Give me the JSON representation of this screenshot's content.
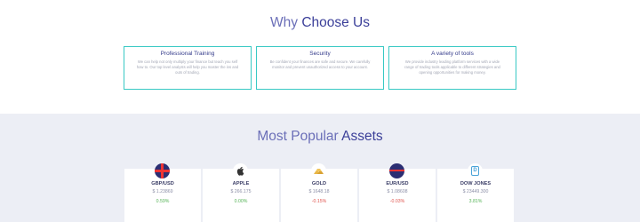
{
  "why": {
    "title_plain": "Why",
    "title_accent": "Choose Us",
    "features": [
      {
        "title": "Professional Training",
        "desc": "We can help not only multiply your finance but teach you self how to. Our top level analysts will help you master the ins and outs of trading."
      },
      {
        "title": "Security",
        "desc": "Be confident your finances are safe and secure. We carefully monitor and prevent unauthorized access to your account."
      },
      {
        "title": "A variety of tools",
        "desc": "We provide industry leading platform services with a wide range of trading tools applicable to different strategies and opening opportunities for making money."
      }
    ]
  },
  "assets": {
    "title_plain": "Most Popular",
    "title_accent": "Assets",
    "items": [
      {
        "name": "GBP/USD",
        "price": "$ 1.23869",
        "change": "0.59%",
        "trend": "pos",
        "icon": "uk-flag-icon"
      },
      {
        "name": "APPLE",
        "price": "$ 266.175",
        "change": "0.00%",
        "trend": "zero",
        "icon": "apple-icon"
      },
      {
        "name": "GOLD",
        "price": "$ 1648.18",
        "change": "-0.15%",
        "trend": "neg",
        "icon": "gold-bars-icon"
      },
      {
        "name": "EUR/USD",
        "price": "$ 1.08608",
        "change": "-0.03%",
        "trend": "neg",
        "icon": "us-flag-icon"
      },
      {
        "name": "DOW JONES",
        "price": "$ 23449.300",
        "change": "3.81%",
        "trend": "pos",
        "icon": "dow-jones-icon"
      }
    ]
  },
  "colors": {
    "accent_teal": "#38c9c4",
    "title_dark": "#3b3f99",
    "positive": "#55b356",
    "negative": "#e0554f"
  }
}
